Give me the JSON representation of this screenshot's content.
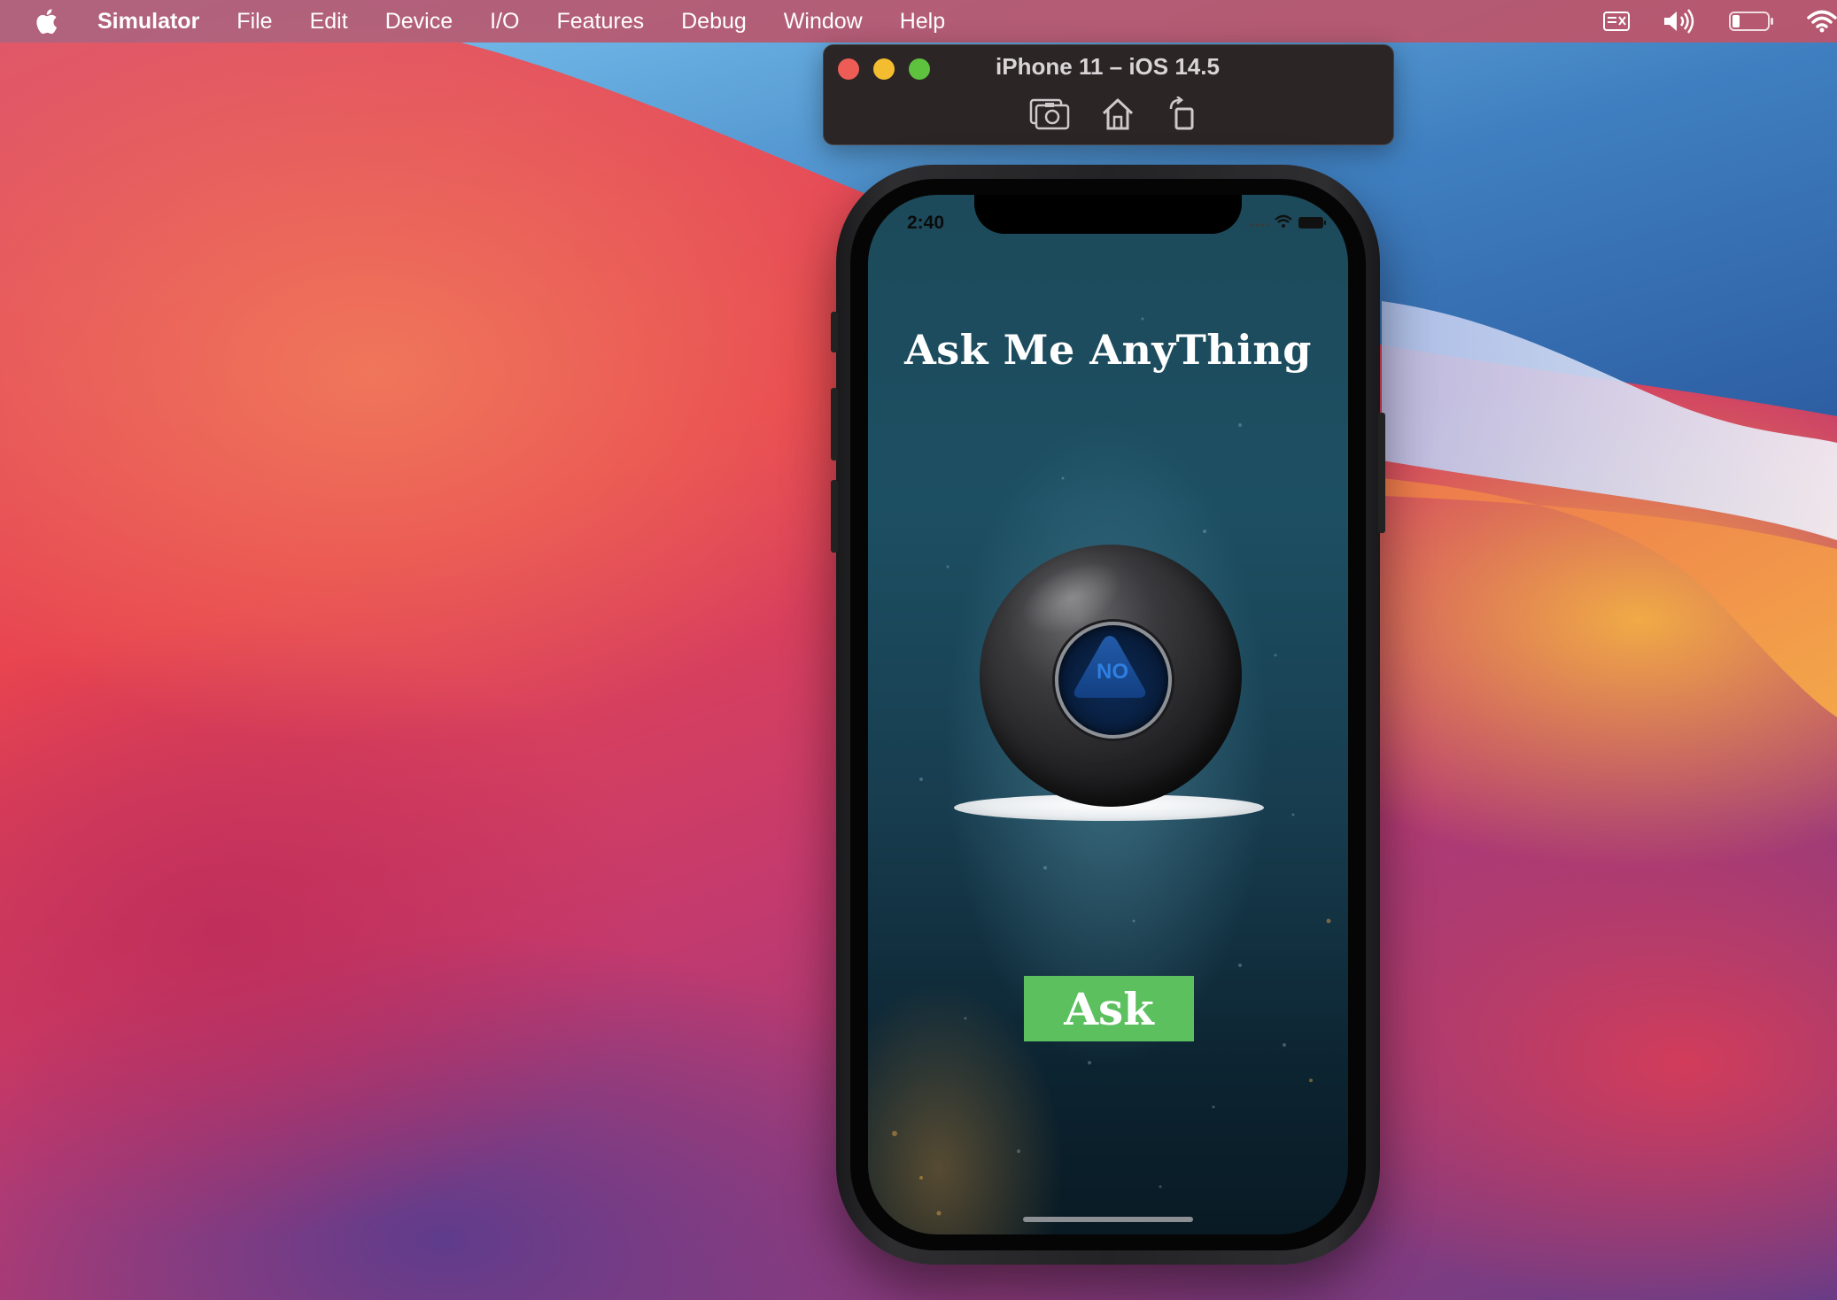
{
  "menubar": {
    "app_name": "Simulator",
    "items": [
      "File",
      "Edit",
      "Device",
      "I/O",
      "Features",
      "Debug",
      "Window",
      "Help"
    ],
    "tray_icons": [
      "input-source-icon",
      "volume-icon",
      "battery-icon",
      "wifi-icon"
    ]
  },
  "simulator": {
    "window_title": "iPhone 11 – iOS 14.5",
    "toolbar": [
      "screenshot-icon",
      "home-icon",
      "rotate-icon"
    ]
  },
  "device": {
    "status_time": "2:40"
  },
  "app": {
    "title": "Ask Me AnyThing",
    "answer": "NO",
    "ask_label": "Ask"
  },
  "colors": {
    "ask_button": "#5cc05f",
    "answer_text": "#2f7fe0",
    "close": "#ee5c56",
    "minimize": "#f4bd2f",
    "maximize": "#5fc23f"
  }
}
